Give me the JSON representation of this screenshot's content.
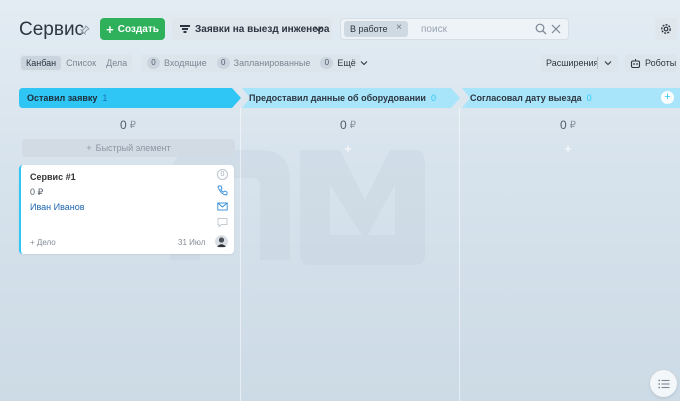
{
  "header": {
    "title": "Сервис",
    "create_label": "Создать",
    "pipeline_label": "Заявки на выезд инженера",
    "filter_chip": "В работе",
    "search_placeholder": "поиск"
  },
  "toolbar": {
    "views": [
      "Канбан",
      "Список",
      "Дела"
    ],
    "counters": [
      {
        "count": "0",
        "label": "Входящие"
      },
      {
        "count": "0",
        "label": "Запланированные"
      },
      {
        "count": "0",
        "label": "Ещё"
      }
    ],
    "extensions_label": "Расширения",
    "robots_label": "Роботы"
  },
  "columns": [
    {
      "title": "Оставил заявку",
      "count": "1",
      "sum": "0",
      "currency": "₽",
      "color": "#2fc6f6"
    },
    {
      "title": "Предоставил данные об оборудовании",
      "count": "0",
      "sum": "0",
      "currency": "₽",
      "color": "#a8e5fa"
    },
    {
      "title": "Согласовал дату выезда",
      "count": "0",
      "sum": "0",
      "currency": "₽",
      "color": "#a8e5fa"
    }
  ],
  "quick_add_label": "Быстрый элемент",
  "card": {
    "title": "Сервис #1",
    "price": "0 ₽",
    "client": "Иван Иванов",
    "counter": "0",
    "add_activity": "+ Дело",
    "date": "31 Июл"
  },
  "colors": {
    "accent_green": "#2fb15b",
    "stage_blue": "#2fc6f6",
    "link_blue": "#2067b0"
  }
}
